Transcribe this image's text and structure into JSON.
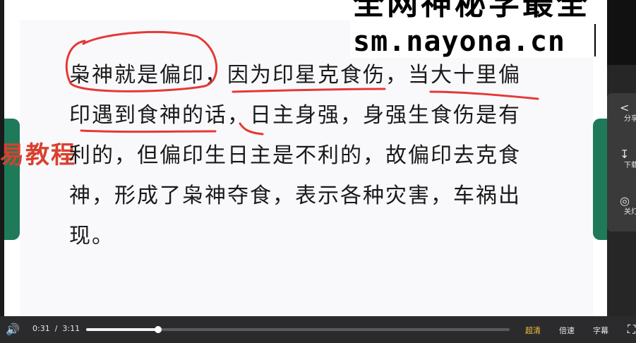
{
  "overlay": {
    "line1": "全网神秘学最全",
    "line2": "sm.nayona.cn"
  },
  "slide": {
    "watermark": "易教程",
    "lines": [
      "枭神就是偏印，因为印星克食伤，当大十里偏",
      "印遇到食神的话，日主身强，身强生食伤是有",
      "利的，但偏印生日主是不利的，故偏印去克食",
      "神，形成了枭神夺食，表示各种灾害，车祸出",
      "现。"
    ],
    "annotation_color": "#e53935"
  },
  "sidebar": {
    "share": {
      "icon": "share-icon",
      "label": "分享"
    },
    "download": {
      "icon": "download-icon",
      "label": "下载"
    },
    "lightoff": {
      "icon": "bulb-icon",
      "label": "关灯"
    }
  },
  "controls": {
    "time_current": "0:31",
    "time_total": "3:11",
    "progress_fraction": 0.17,
    "quality_label": "超清",
    "speed_label": "倍速",
    "subtitle_label": "字幕",
    "accent_color": "#f1c232"
  }
}
